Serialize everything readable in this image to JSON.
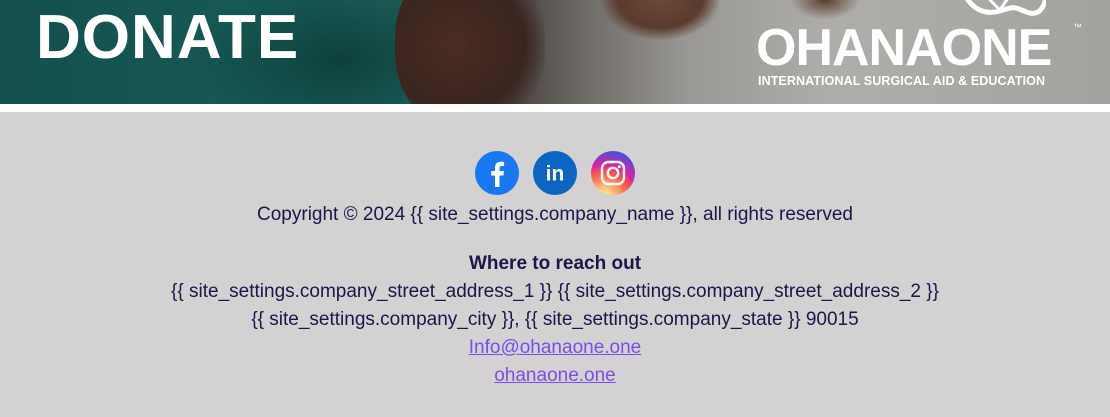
{
  "banner": {
    "title": "DONATE",
    "logo_text": "OHANAONE",
    "logo_tm": "™",
    "logo_tagline": "INTERNATIONAL SURGICAL AID & EDUCATION"
  },
  "social": {
    "items": [
      {
        "name": "facebook",
        "icon": "facebook-icon",
        "color": "#1877f2"
      },
      {
        "name": "linkedin",
        "icon": "linkedin-icon",
        "color": "#0a66c2",
        "glyph": "in"
      },
      {
        "name": "instagram",
        "icon": "instagram-icon",
        "color": "#d6249f"
      }
    ]
  },
  "footer": {
    "copyright": "Copyright © 2024  {{ site_settings.company_name }}, all rights reserved",
    "reach_heading": "Where to reach out",
    "address_line_1": "{{ site_settings.company_street_address_1 }} {{ site_settings.company_street_address_2 }}",
    "address_line_2": "{{ site_settings.company_city }}, {{ site_settings.company_state }} 90015",
    "email": "Info@ohanaone.one",
    "website": "ohanaone.one"
  },
  "colors": {
    "footer_bg": "#d3d1d2",
    "text": "#1e1548",
    "link": "#7b4fe6"
  }
}
